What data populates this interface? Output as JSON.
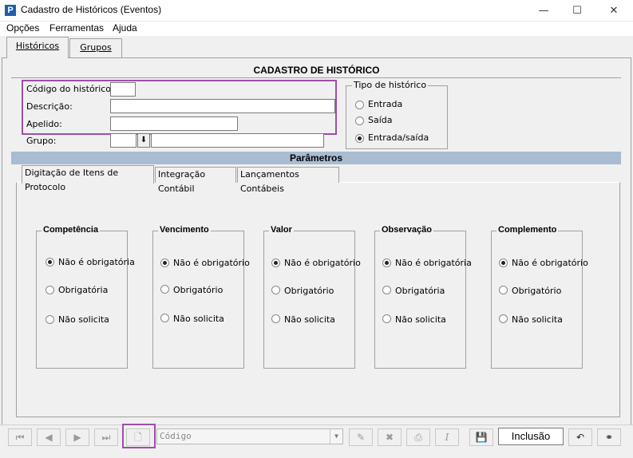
{
  "window": {
    "title": "Cadastro de Históricos (Eventos)",
    "app_icon_letter": "P",
    "minimize": "—",
    "maximize": "☐",
    "close": "✕"
  },
  "menu": [
    "Opções",
    "Ferramentas",
    "Ajuda"
  ],
  "tabs": [
    {
      "label": "Históricos",
      "active": true
    },
    {
      "label": "Grupos",
      "active": false
    }
  ],
  "form": {
    "title": "CADASTRO DE HISTÓRICO",
    "fields": {
      "codigo_label": "Código do histórico:",
      "codigo_value": "",
      "descricao_label": "Descrição:",
      "descricao_value": "",
      "apelido_label": "Apelido:",
      "apelido_value": "",
      "grupo_label": "Grupo:",
      "grupo_code": "",
      "grupo_name": ""
    },
    "tipo": {
      "legend": "Tipo de histórico",
      "options": [
        {
          "label": "Entrada",
          "checked": false
        },
        {
          "label": "Saída",
          "checked": false
        },
        {
          "label": "Entrada/saída",
          "checked": true
        }
      ]
    }
  },
  "parametros": {
    "title": "Parâmetros",
    "subtabs": [
      {
        "label": "Digitação de Itens de  Protocolo",
        "active": true
      },
      {
        "label": "Integração Contábil",
        "active": false
      },
      {
        "label": "Lançamentos Contábeis",
        "active": false
      }
    ],
    "groups": [
      {
        "title": "Competência",
        "options": [
          "Não é obrigatória",
          "Obrigatória",
          "Não solicita"
        ],
        "selected": 0
      },
      {
        "title": "Vencimento",
        "options": [
          "Não é obrigatório",
          "Obrigatório",
          "Não solicita"
        ],
        "selected": 0
      },
      {
        "title": "Valor",
        "options": [
          "Não é obrigatório",
          "Obrigatório",
          "Não solicita"
        ],
        "selected": 0
      },
      {
        "title": "Observação",
        "options": [
          "Não é obrigatória",
          "Obrigatória",
          "Não solicita"
        ],
        "selected": 0
      },
      {
        "title": "Complemento",
        "options": [
          "Não é obrigatório",
          "Obrigatório",
          "Não solicita"
        ],
        "selected": 0
      }
    ]
  },
  "toolbar": {
    "search_placeholder": "Código",
    "mode": "Inclusão",
    "icons": [
      "first-icon",
      "prev-icon",
      "next-icon",
      "last-icon",
      "new-document-icon",
      "edit-icon",
      "delete-icon",
      "print-icon",
      "italic-icon",
      "save-icon",
      "undo-icon",
      "binoculars-icon"
    ]
  },
  "colors": {
    "highlight": "#9b4fa8",
    "section_bar": "#a8bcd2"
  }
}
